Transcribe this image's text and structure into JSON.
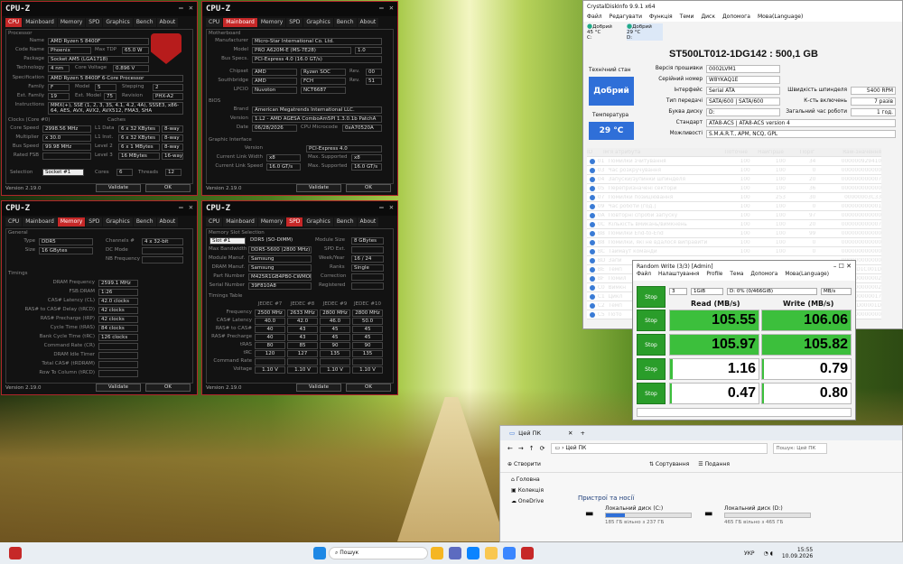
{
  "cpuz_common": {
    "title": "CPU-Z",
    "version": "Version 2.19.0",
    "validate": "Validate",
    "ok": "OK",
    "tabs": [
      "CPU",
      "Mainboard",
      "Memory",
      "SPD",
      "Graphics",
      "Bench",
      "About"
    ]
  },
  "cpu": {
    "section": "Processor",
    "name_l": "Name",
    "name": "AMD Ryzen 5 8400F",
    "codename_l": "Code Name",
    "codename": "Phoenix",
    "maxtdp_l": "Max TDP",
    "maxtdp": "65.0 W",
    "package_l": "Package",
    "package": "Socket AM5 (LGA1718)",
    "tech_l": "Technology",
    "tech": "4 nm",
    "corev_l": "Core Voltage",
    "corev": "0.896 V",
    "spec_l": "Specification",
    "spec": "AMD Ryzen 5 8400F 6-Core Processor",
    "family_l": "Family",
    "family": "F",
    "model_l": "Model",
    "model": "5",
    "stepping_l": "Stepping",
    "stepping": "2",
    "extfam_l": "Ext. Family",
    "extfam": "19",
    "extmod_l": "Ext. Model",
    "extmod": "75",
    "rev_l": "Revision",
    "rev": "PHX-A2",
    "instr_l": "Instructions",
    "instr": "MMX(+), SSE (1, 2, 3, 3S, 4.1, 4.2, 4A), SSSE3, x86-64, AES, AVX, AVX2, AVX512, FMA3, SHA",
    "clocks_l": "Clocks (Core #0)",
    "caches_l": "Caches",
    "corespeed_l": "Core Speed",
    "corespeed": "2998.56 MHz",
    "mult_l": "Multiplier",
    "mult": "x 30.0",
    "bus_l": "Bus Speed",
    "bus": "99.98 MHz",
    "fsb_l": "Rated FSB",
    "l1d_l": "L1 Data",
    "l1d": "6 x 32 KBytes",
    "l1d_w": "8-way",
    "l1i_l": "L1 Inst.",
    "l1i": "6 x 32 KBytes",
    "l1i_w": "8-way",
    "l2_l": "Level 2",
    "l2": "6 x 1 MBytes",
    "l2_w": "8-way",
    "l3_l": "Level 3",
    "l3": "16 MBytes",
    "l3_w": "16-way",
    "sel_l": "Selection",
    "sel": "Socket #1",
    "cores_l": "Cores",
    "cores": "6",
    "threads_l": "Threads",
    "threads": "12"
  },
  "mb": {
    "section": "Motherboard",
    "manu_l": "Manufacturer",
    "manu": "Micro-Star International Co. Ltd.",
    "model_l": "Model",
    "model": "PRO A620M-E (MS-7E28)",
    "model_rev": "1.0",
    "busspecs_l": "Bus Specs.",
    "busspecs": "PCI-Express 4.0 (16.0 GT/s)",
    "chipset_l": "Chipset",
    "chipset": "AMD",
    "chipset2": "Ryzen SOC",
    "chipset_rev_l": "Rev.",
    "chipset_rev": "00",
    "south_l": "Southbridge",
    "south": "AMD",
    "south2": "FCH",
    "south_rev": "51",
    "lpcio_l": "LPCIO",
    "lpcio": "Nuvoton",
    "lpcio2": "NCT6687",
    "bios_l": "BIOS",
    "brand_l": "Brand",
    "brand": "American Megatrends International LLC.",
    "ver_l": "Version",
    "ver": "1.L2 - AMD AGESA ComboAm5PI 1.3.0.1b PatchA",
    "date_l": "Date",
    "date": "06/28/2026",
    "cpumc_l": "CPU Microcode",
    "cpumc": "0xA70520A",
    "gi_l": "Graphic Interface",
    "giver_l": "Version",
    "giver": "PCI-Express 4.0",
    "clw_l": "Current Link Width",
    "clw": "x8",
    "msw_l": "Max. Supported",
    "msw": "x8",
    "cls_l": "Current Link Speed",
    "cls": "16.0 GT/s",
    "mss_l": "Max. Supported",
    "mss": "16.0 GT/s"
  },
  "mem": {
    "section": "General",
    "type_l": "Type",
    "type": "DDR5",
    "ch_l": "Channels #",
    "ch": "4 x 32-bit",
    "size_l": "Size",
    "size": "16 GBytes",
    "dcm_l": "DC Mode",
    "nbf_l": "NB Frequency",
    "timings": "Timings",
    "dramf_l": "DRAM Frequency",
    "dramf": "2599.1 MHz",
    "fsb_l": "FSB:DRAM",
    "fsb": "1:26",
    "cl_l": "CAS# Latency (CL)",
    "cl": "42.0 clocks",
    "trcd_l": "RAS# to CAS# Delay (tRCD)",
    "trcd": "42 clocks",
    "trp_l": "RAS# Precharge (tRP)",
    "trp": "42 clocks",
    "tras_l": "Cycle Time (tRAS)",
    "tras": "84 clocks",
    "trc_l": "Bank Cycle Time (tRC)",
    "trc": "126 clocks",
    "cr_l": "Command Rate (CR)",
    "idle_l": "DRAM Idle Timer",
    "rdram_l": "Total CAS# (tRDRAM)",
    "rtc_l": "Row To Column (tRCD)"
  },
  "spd": {
    "section": "Memory Slot Selection",
    "slot": "Slot #1",
    "slottype": "DDR5 (SO-DIMM)",
    "modsize_l": "Module Size",
    "modsize": "8 GBytes",
    "maxbw_l": "Max Bandwidth",
    "maxbw": "DDR5-5600 (2800 MHz)",
    "spdext_l": "SPD Ext.",
    "modmanu_l": "Module Manuf.",
    "modmanu": "Samsung",
    "week_l": "Week/Year",
    "week": "16 / 24",
    "drammanu_l": "DRAM Manuf.",
    "drammanu": "Samsung",
    "ranks_l": "Ranks",
    "ranks": "Single",
    "part_l": "Part Number",
    "part": "M425R1GB4PB0-CWMOD",
    "corr_l": "Correction",
    "serial_l": "Serial Number",
    "serial": "39F810A8",
    "reg_l": "Registered",
    "tt": "Timings Table",
    "cols": [
      "JEDEC #7",
      "JEDEC #8",
      "JEDEC #9",
      "JEDEC #10"
    ],
    "rows": [
      {
        "l": "Frequency",
        "v": [
          "2500 MHz",
          "2633 MHz",
          "2800 MHz",
          "2800 MHz"
        ]
      },
      {
        "l": "CAS# Latency",
        "v": [
          "40.0",
          "42.0",
          "46.0",
          "50.0"
        ]
      },
      {
        "l": "RAS# to CAS#",
        "v": [
          "40",
          "43",
          "45",
          "45"
        ]
      },
      {
        "l": "RAS# Precharge",
        "v": [
          "40",
          "43",
          "45",
          "45"
        ]
      },
      {
        "l": "tRAS",
        "v": [
          "80",
          "85",
          "90",
          "90"
        ]
      },
      {
        "l": "tRC",
        "v": [
          "120",
          "127",
          "135",
          "135"
        ]
      },
      {
        "l": "Command Rate",
        "v": [
          "",
          "",
          "",
          ""
        ]
      },
      {
        "l": "Voltage",
        "v": [
          "1.10 V",
          "1.10 V",
          "1.10 V",
          "1.10 V"
        ]
      }
    ]
  },
  "cdi": {
    "title": "CrystalDiskInfo 9.9.1 x64",
    "menu": [
      "Файл",
      "Редагувати",
      "Функція",
      "Теми",
      "Диск",
      "Допомога",
      "Мова(Language)"
    ],
    "d1": "Добрий",
    "d1t": "45 °C",
    "d1l": "C:",
    "d2": "Добрий",
    "d2t": "29 °C",
    "d2l": "D:",
    "model": "ST500LT012-1DG142 : 500,1 GB",
    "health_l": "Технічний стан",
    "health": "Добрий",
    "temp_l": "Температура",
    "temp": "29 °C",
    "fw_l": "Версія прошивки",
    "fw": "0002LVM1",
    "sn_l": "Серійний номер",
    "sn": "W8YKAQ1E",
    "if_l": "Інтерфейс",
    "if": "Serial ATA",
    "tm_l": "Тип передачі",
    "tm": "SATA/600 | SATA/600",
    "dl_l": "Буква диску",
    "dl": "D:",
    "std_l": "Стандарт",
    "std": "ATA8-ACS | ATA8-ACS version 4",
    "feat_l": "Можливості",
    "feat": "S.M.A.R.T., APM, NCQ, GPL",
    "rr_l": "Швидкість шпинделя",
    "rr": "5400 RPM",
    "pc_l": "К-сть включень",
    "pc": "7 разів",
    "ph_l": "Загальний час роботи",
    "ph": "1 год.",
    "cols": [
      "ID",
      "Ім'я атрибута",
      "Поточне",
      "Найгірше",
      "Поріг",
      "Raw-значення"
    ],
    "rows": [
      [
        "01",
        "Помилки зчитування",
        "100",
        "100",
        "34",
        "000000929410"
      ],
      [
        "03",
        "Час розкручування",
        "100",
        "100",
        "0",
        "000000000000"
      ],
      [
        "04",
        "Запуски/зупинки шпинделя",
        "100",
        "100",
        "20",
        "000000000007"
      ],
      [
        "05",
        "Перепризначені сектори",
        "100",
        "100",
        "36",
        "000000000000"
      ],
      [
        "07",
        "Помилки позиціювання",
        "100",
        "253",
        "30",
        "00000003C33"
      ],
      [
        "09",
        "Час роботи (год.)",
        "100",
        "100",
        "0",
        "000000000001"
      ],
      [
        "0A",
        "Повторні спроби запуску",
        "100",
        "100",
        "97",
        "000000000000"
      ],
      [
        "0C",
        "Кількість вмикань/вимкнень",
        "100",
        "100",
        "20",
        "000000000007"
      ],
      [
        "BB",
        "Помилки End-to-End",
        "100",
        "100",
        "99",
        "000000000000"
      ],
      [
        "B8",
        "Помилки, які не вдалося виправити",
        "100",
        "100",
        "0",
        "000000000000"
      ],
      [
        "BC",
        "Таймаут команди",
        "100",
        "100",
        "0",
        "000000000000"
      ],
      [
        "BD",
        "Запи",
        "",
        "",
        "",
        "000000000000"
      ],
      [
        "BE",
        "Темп",
        "",
        "",
        "",
        "00001D1C001D"
      ],
      [
        "BF",
        "Помил",
        "",
        "",
        "",
        "000000000002"
      ],
      [
        "C0",
        "Вимкн",
        "",
        "",
        "",
        "000000000002"
      ],
      [
        "C1",
        "Цикл",
        "",
        "",
        "",
        "000000000017"
      ],
      [
        "C2",
        "Темп",
        "",
        "",
        "",
        "00001D00001D"
      ],
      [
        "C5",
        "Пото",
        "",
        "",
        "",
        "000000000000"
      ]
    ]
  },
  "rw": {
    "title": "Random Write (3/3) [Admin]",
    "menu": [
      "Файл",
      "Налаштування",
      "Profile",
      "Тема",
      "Допомога",
      "Мова(Language)"
    ],
    "count": "3",
    "size": "1GiB",
    "drive": "D: 0% (0/466GiB)",
    "unit": "MB/s",
    "stop": "Stop",
    "read_h": "Read (MB/s)",
    "write_h": "Write (MB/s)",
    "rows": [
      {
        "r": "105.55",
        "w": "106.06",
        "rf": 1.0,
        "wf": 1.0
      },
      {
        "r": "105.97",
        "w": "105.82",
        "rf": 1.0,
        "wf": 1.0
      },
      {
        "r": "1.16",
        "w": "0.79",
        "rf": 0.03,
        "wf": 0.02
      },
      {
        "r": "0.47",
        "w": "0.80",
        "rf": 0.02,
        "wf": 0.02
      }
    ]
  },
  "exp": {
    "title": "Цей ПК",
    "addr": "Цей ПК",
    "search": "Пошук: Цей ПК",
    "new": "Створити",
    "sort": "Сортування",
    "view": "Подання",
    "nav": [
      "Головна",
      "Колекція",
      "OneDrive"
    ],
    "section": "Пристрої та носії",
    "c_name": "Локальний диск (C:)",
    "c_free": "185 ГБ вільно з 237 ГБ",
    "c_frac": 0.22,
    "d_name": "Локальний диск (D:)",
    "d_free": "465 ГБ вільно з 465 ГБ",
    "d_frac": 0.0
  },
  "tb": {
    "search": "Пошук",
    "lang": "УКР",
    "time": "15:55",
    "date": "10.09.2026"
  }
}
